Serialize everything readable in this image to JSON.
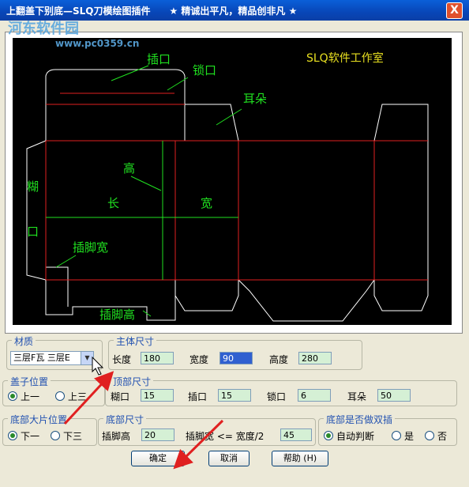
{
  "window": {
    "title": "上翻盖下别底—SLQ刀模绘图插件　　★ 精诚出平凡，精品创非凡 ★",
    "close_label": "X",
    "watermark": "河东软件园",
    "watermark_url": "www.pc0359.cn"
  },
  "diagram": {
    "studio_label": "SLQ软件工作室",
    "labels": {
      "insert_mouth": "插口",
      "lock_mouth": "锁口",
      "ear": "耳朵",
      "height": "高",
      "paste_1": "糊",
      "paste_2": "口",
      "length": "长",
      "width": "宽",
      "foot_width": "插脚宽",
      "foot_height": "插脚高"
    }
  },
  "material": {
    "group_label": "材质",
    "value": "三层F瓦 三层E"
  },
  "main_size": {
    "group_label": "主体尺寸",
    "length_label": "长度",
    "length_value": "180",
    "width_label": "宽度",
    "width_value": "90",
    "height_label": "高度",
    "height_value": "280"
  },
  "lid_position": {
    "group_label": "盖子位置",
    "option_1": "上一",
    "option_2": "上三",
    "selected": "上一"
  },
  "top_size": {
    "group_label": "顶部尺寸",
    "paste_label": "糊口",
    "paste_value": "15",
    "insert_label": "插口",
    "insert_value": "15",
    "lock_label": "锁口",
    "lock_value": "6",
    "ear_label": "耳朵",
    "ear_value": "50"
  },
  "bottom_position": {
    "group_label": "底部大片位置",
    "option_1": "下一",
    "option_2": "下三",
    "selected": "下一"
  },
  "bottom_size": {
    "group_label": "底部尺寸",
    "foot_height_label": "插脚高",
    "foot_height_value": "20",
    "foot_width_label": "插脚宽 <= 宽度/2",
    "foot_width_value": "45"
  },
  "double_insert": {
    "group_label": "底部是否做双插",
    "option_auto": "自动判断",
    "option_yes": "是",
    "option_no": "否",
    "selected": "自动判断"
  },
  "buttons": {
    "ok": "确定",
    "cancel": "取消",
    "help": "帮助 (H)"
  },
  "colors": {
    "cut_line": "#ffffff",
    "fold_line": "#e02020",
    "annotation": "#20e020",
    "studio_text": "#e8e020",
    "arrow": "#e02020"
  }
}
